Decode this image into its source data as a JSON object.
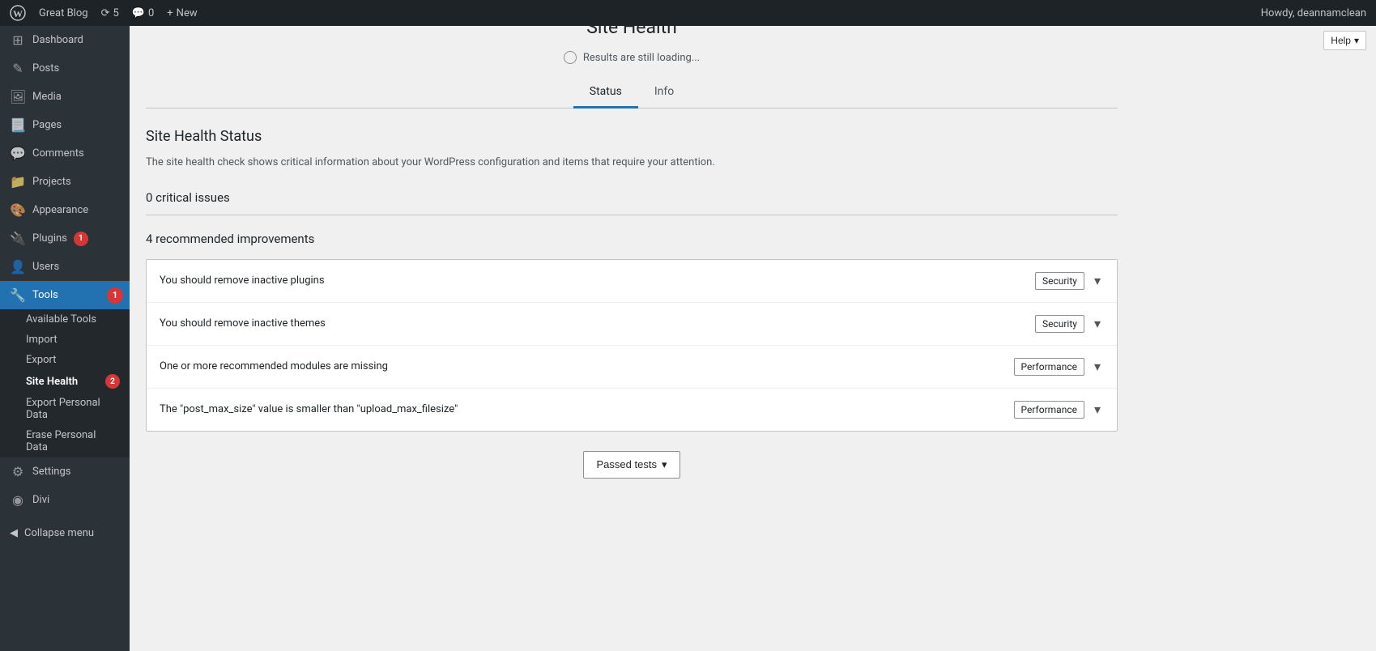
{
  "adminbar": {
    "logo_title": "WordPress",
    "site_name": "Great Blog",
    "updates_count": "5",
    "comments_count": "0",
    "new_label": "New",
    "howdy": "Howdy, deannamclean"
  },
  "help_button": {
    "label": "Help",
    "chevron": "▾"
  },
  "sidebar": {
    "items": [
      {
        "id": "dashboard",
        "label": "Dashboard",
        "icon": "⊞"
      },
      {
        "id": "posts",
        "label": "Posts",
        "icon": "📄"
      },
      {
        "id": "media",
        "label": "Media",
        "icon": "🖼"
      },
      {
        "id": "pages",
        "label": "Pages",
        "icon": "📃"
      },
      {
        "id": "comments",
        "label": "Comments",
        "icon": "💬"
      },
      {
        "id": "projects",
        "label": "Projects",
        "icon": "📁"
      },
      {
        "id": "appearance",
        "label": "Appearance",
        "icon": "🎨"
      },
      {
        "id": "plugins",
        "label": "Plugins",
        "icon": "🔌",
        "badge": "1"
      },
      {
        "id": "users",
        "label": "Users",
        "icon": "👤"
      },
      {
        "id": "tools",
        "label": "Tools",
        "icon": "🔧",
        "active": true,
        "badge": "1"
      }
    ],
    "tools_submenu": [
      {
        "id": "available-tools",
        "label": "Available Tools"
      },
      {
        "id": "import",
        "label": "Import"
      },
      {
        "id": "export",
        "label": "Export"
      },
      {
        "id": "site-health",
        "label": "Site Health",
        "active": true,
        "badge": "2"
      },
      {
        "id": "export-personal-data",
        "label": "Export Personal Data"
      },
      {
        "id": "erase-personal-data",
        "label": "Erase Personal Data"
      }
    ],
    "settings": {
      "label": "Settings",
      "icon": "⚙"
    },
    "divi": {
      "label": "Divi",
      "icon": "◉"
    },
    "collapse": {
      "label": "Collapse menu",
      "icon": "◀"
    }
  },
  "page": {
    "title": "Site Health",
    "loading_text": "Results are still loading...",
    "tabs": [
      {
        "id": "status",
        "label": "Status",
        "active": true
      },
      {
        "id": "info",
        "label": "Info"
      }
    ],
    "status": {
      "section_title": "Site Health Status",
      "section_desc": "The site health check shows critical information about your WordPress configuration and items that require your attention.",
      "critical_issues": "0 critical issues",
      "recommended_improvements": "4 recommended improvements",
      "items": [
        {
          "id": "inactive-plugins",
          "label": "You should remove inactive plugins",
          "tag": "Security",
          "tag_type": "security"
        },
        {
          "id": "inactive-themes",
          "label": "You should remove inactive themes",
          "tag": "Security",
          "tag_type": "security"
        },
        {
          "id": "missing-modules",
          "label": "One or more recommended modules are missing",
          "tag": "Performance",
          "tag_type": "performance"
        },
        {
          "id": "post-max-size",
          "label": "The \"post_max_size\" value is smaller than \"upload_max_filesize\"",
          "tag": "Performance",
          "tag_type": "performance"
        }
      ],
      "passed_tests_label": "Passed tests",
      "passed_tests_chevron": "▾"
    }
  }
}
